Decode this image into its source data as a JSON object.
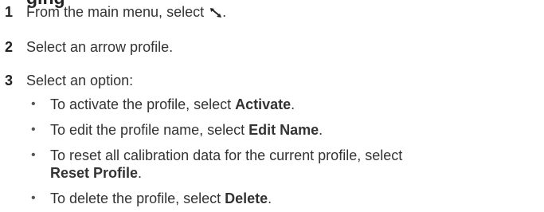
{
  "heading": "ging",
  "steps": [
    {
      "num": "1",
      "text": "From the main menu, select",
      "after_icon": ".",
      "icon": "arrow-tool-icon"
    },
    {
      "num": "2",
      "text": "Select an arrow profile."
    },
    {
      "num": "3",
      "text": "Select an option:"
    }
  ],
  "options": [
    {
      "prefix": "To activate the profile, select ",
      "bold": "Activate",
      "suffix": "."
    },
    {
      "prefix": "To edit the profile name, select ",
      "bold": "Edit Name",
      "suffix": "."
    },
    {
      "prefix": "To reset all calibration data for the current profile, select",
      "bold": "Reset Profile",
      "suffix": "."
    },
    {
      "prefix": "To delete the profile, select ",
      "bold": "Delete",
      "suffix": "."
    }
  ],
  "bullet_glyph": "•"
}
